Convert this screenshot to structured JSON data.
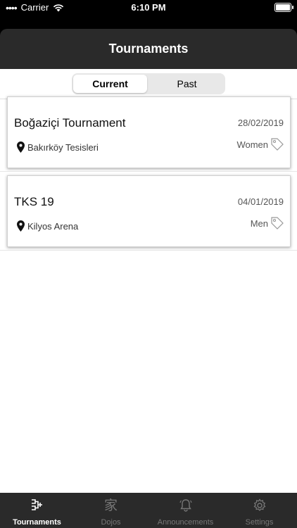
{
  "status_bar": {
    "carrier": "Carrier",
    "time": "6:10 PM"
  },
  "header": {
    "title": "Tournaments"
  },
  "segments": {
    "current": "Current",
    "past": "Past"
  },
  "tournaments": [
    {
      "name": "Boğaziçi Tournament",
      "date": "28/02/2019",
      "location": "Bakırköy Tesisleri",
      "category": "Women"
    },
    {
      "name": "TKS 19",
      "date": "04/01/2019",
      "location": "Kilyos Arena",
      "category": "Men"
    }
  ],
  "tabs": [
    {
      "label": "Tournaments",
      "icon": "bracket-icon"
    },
    {
      "label": "Dojos",
      "icon": "house-kanji-icon"
    },
    {
      "label": "Announcements",
      "icon": "bell-icon"
    },
    {
      "label": "Settings",
      "icon": "gear-icon"
    }
  ],
  "colors": {
    "header_bg": "#2a2a2a",
    "tab_active": "#ffffff",
    "tab_inactive": "#777777"
  }
}
